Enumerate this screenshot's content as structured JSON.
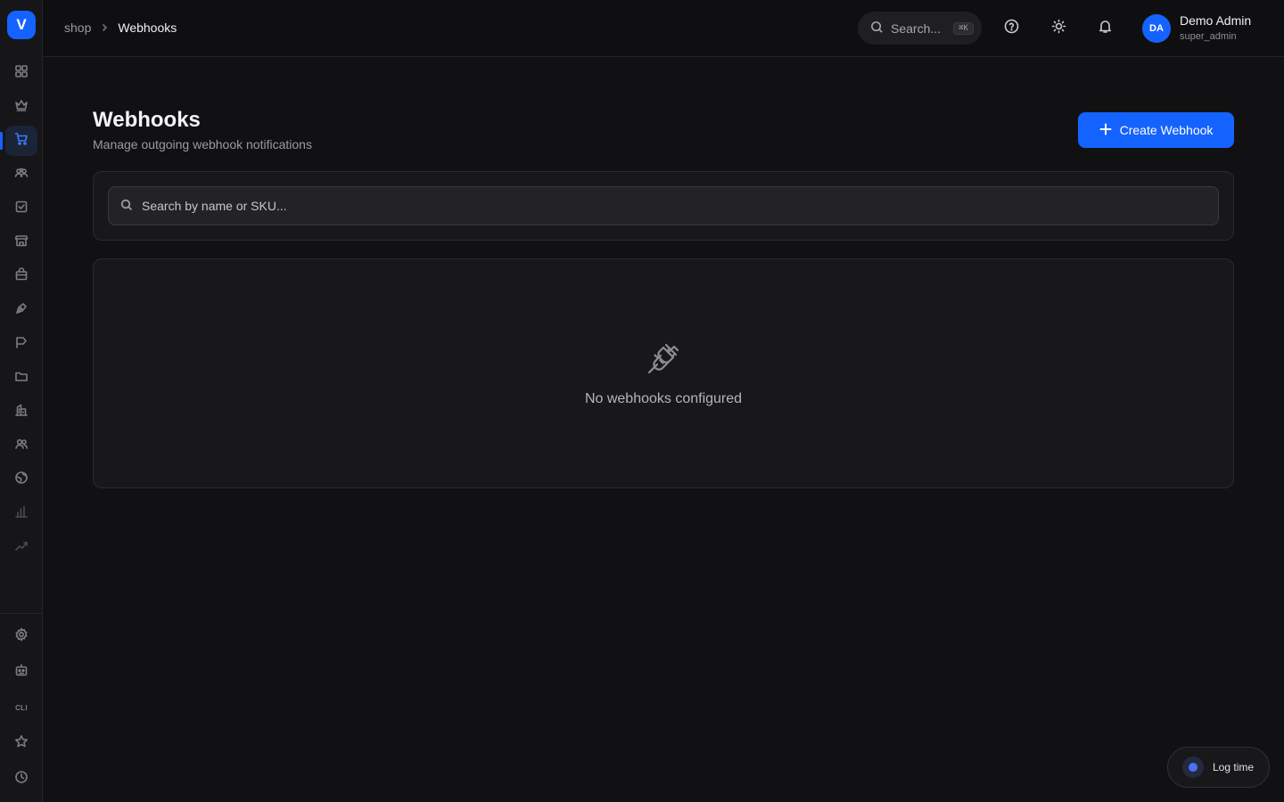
{
  "app": {
    "logo_letter": "V"
  },
  "sidebar": {
    "items": [
      {
        "icon": "grid-icon"
      },
      {
        "icon": "crown-icon"
      },
      {
        "icon": "cart-icon",
        "active": true
      },
      {
        "icon": "users-group-icon"
      },
      {
        "icon": "checkbox-icon"
      },
      {
        "icon": "store-icon"
      },
      {
        "icon": "shopping-bag-icon"
      },
      {
        "icon": "pen-tool-icon"
      },
      {
        "icon": "flag-icon"
      },
      {
        "icon": "folder-icon"
      },
      {
        "icon": "building-icon"
      },
      {
        "icon": "users-icon"
      },
      {
        "icon": "globe-icon"
      },
      {
        "icon": "bar-chart-icon"
      },
      {
        "icon": "trend-line-icon"
      }
    ],
    "bottom": [
      {
        "icon": "gear-icon"
      },
      {
        "icon": "robot-icon"
      },
      {
        "label": "CLI"
      },
      {
        "icon": "star-icon"
      },
      {
        "icon": "clock-icon"
      }
    ]
  },
  "header": {
    "breadcrumb": {
      "parent": "shop",
      "current": "Webhooks"
    },
    "search": {
      "label": "Search...",
      "shortcut": "⌘K"
    },
    "user": {
      "initials": "DA",
      "name": "Demo Admin",
      "role": "super_admin"
    }
  },
  "page": {
    "title": "Webhooks",
    "subtitle": "Manage outgoing webhook notifications",
    "create_button": "Create Webhook",
    "search_placeholder": "Search by name or SKU...",
    "empty_state": "No webhooks configured"
  },
  "floating": {
    "log_time": "Log time"
  },
  "colors": {
    "accent": "#1563ff",
    "background": "#111114",
    "card": "#18181b"
  }
}
